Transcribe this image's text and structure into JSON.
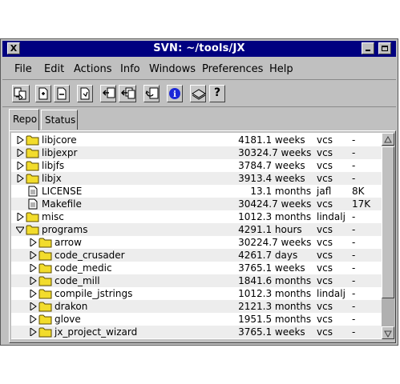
{
  "window": {
    "title": "SVN: ~/tools/JX",
    "close_glyph": "X"
  },
  "menu": [
    "File",
    "Edit",
    "Actions",
    "Info",
    "Windows",
    "Preferences",
    "Help"
  ],
  "toolbar": {
    "icons": [
      "update-icon",
      "add-icon",
      "remove-icon",
      "resolve-icon",
      "commit-icon",
      "commit-all-icon",
      "revert-icon",
      "info-icon",
      "repository-icon",
      "help-icon"
    ],
    "help_glyph": "?",
    "info_glyph": "i"
  },
  "tabs": [
    {
      "label": "Repo",
      "active": true
    },
    {
      "label": "Status",
      "active": false
    }
  ],
  "colors": {
    "title_bar": "#000080",
    "folder": "#f2dc2c",
    "info_button": "#1c28d8"
  },
  "list": {
    "rows": [
      {
        "name": "libjcore",
        "type": "folder",
        "depth": 0,
        "expanded": false,
        "revision": "418",
        "age": "1.1 weeks",
        "author": "vcs",
        "size": "-"
      },
      {
        "name": "libjexpr",
        "type": "folder",
        "depth": 0,
        "expanded": false,
        "revision": "303",
        "age": "24.7 weeks",
        "author": "vcs",
        "size": "-"
      },
      {
        "name": "libjfs",
        "type": "folder",
        "depth": 0,
        "expanded": false,
        "revision": "378",
        "age": "4.7 weeks",
        "author": "vcs",
        "size": "-"
      },
      {
        "name": "libjx",
        "type": "folder",
        "depth": 0,
        "expanded": false,
        "revision": "391",
        "age": "3.4 weeks",
        "author": "vcs",
        "size": "-"
      },
      {
        "name": "LICENSE",
        "type": "file",
        "depth": 0,
        "expanded": false,
        "revision": "1",
        "age": "3.1 months",
        "author": "jafl",
        "size": "8K"
      },
      {
        "name": "Makefile",
        "type": "file",
        "depth": 0,
        "expanded": false,
        "revision": "304",
        "age": "24.7 weeks",
        "author": "vcs",
        "size": "17K"
      },
      {
        "name": "misc",
        "type": "folder",
        "depth": 0,
        "expanded": false,
        "revision": "101",
        "age": "2.3 months",
        "author": "lindalj",
        "size": "-"
      },
      {
        "name": "programs",
        "type": "folder",
        "depth": 0,
        "expanded": true,
        "revision": "429",
        "age": "1.1 hours",
        "author": "vcs",
        "size": "-"
      },
      {
        "name": "arrow",
        "type": "folder",
        "depth": 1,
        "expanded": false,
        "revision": "302",
        "age": "24.7 weeks",
        "author": "vcs",
        "size": "-"
      },
      {
        "name": "code_crusader",
        "type": "folder",
        "depth": 1,
        "expanded": false,
        "revision": "426",
        "age": "1.7 days",
        "author": "vcs",
        "size": "-"
      },
      {
        "name": "code_medic",
        "type": "folder",
        "depth": 1,
        "expanded": false,
        "revision": "376",
        "age": "5.1 weeks",
        "author": "vcs",
        "size": "-"
      },
      {
        "name": "code_mill",
        "type": "folder",
        "depth": 1,
        "expanded": false,
        "revision": "184",
        "age": "1.6 months",
        "author": "vcs",
        "size": "-"
      },
      {
        "name": "compile_jstrings",
        "type": "folder",
        "depth": 1,
        "expanded": false,
        "revision": "101",
        "age": "2.3 months",
        "author": "lindalj",
        "size": "-"
      },
      {
        "name": "drakon",
        "type": "folder",
        "depth": 1,
        "expanded": false,
        "revision": "212",
        "age": "1.3 months",
        "author": "vcs",
        "size": "-"
      },
      {
        "name": "glove",
        "type": "folder",
        "depth": 1,
        "expanded": false,
        "revision": "195",
        "age": "1.5 months",
        "author": "vcs",
        "size": "-"
      },
      {
        "name": "jx_project_wizard",
        "type": "folder",
        "depth": 1,
        "expanded": false,
        "revision": "376",
        "age": "5.1 weeks",
        "author": "vcs",
        "size": "-"
      }
    ]
  }
}
